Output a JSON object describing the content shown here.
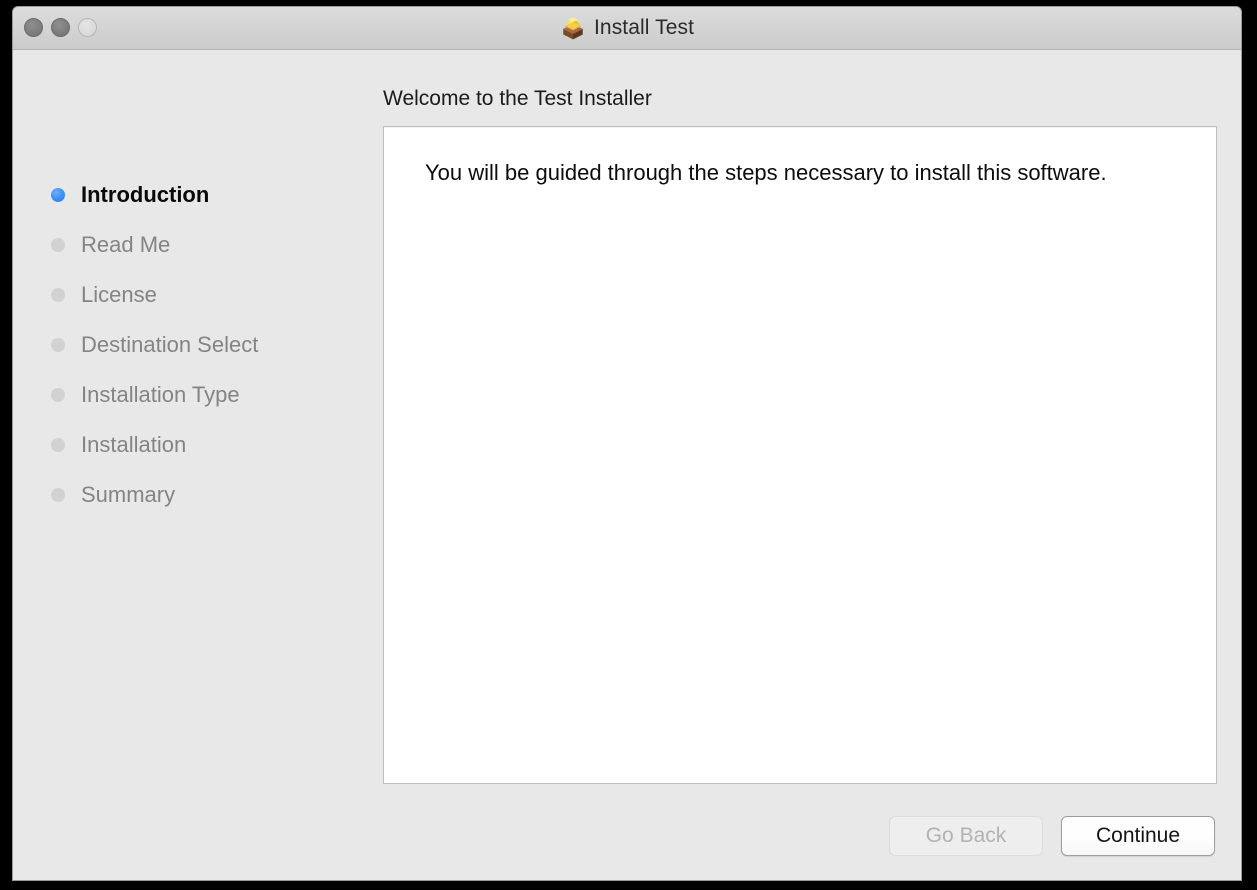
{
  "window": {
    "title": "Install Test",
    "icon": "package-installer-icon",
    "traffic_lights": [
      {
        "name": "close",
        "label": "Close"
      },
      {
        "name": "minimize",
        "label": "Minimize"
      },
      {
        "name": "zoom",
        "label": "Zoom"
      }
    ]
  },
  "sidebar": {
    "steps": [
      {
        "label": "Introduction",
        "active": true
      },
      {
        "label": "Read Me",
        "active": false
      },
      {
        "label": "License",
        "active": false
      },
      {
        "label": "Destination Select",
        "active": false
      },
      {
        "label": "Installation Type",
        "active": false
      },
      {
        "label": "Installation",
        "active": false
      },
      {
        "label": "Summary",
        "active": false
      }
    ]
  },
  "main": {
    "heading": "Welcome to the Test Installer",
    "body_text": "You will be guided through the steps necessary to install this software."
  },
  "footer": {
    "go_back_label": "Go Back",
    "continue_label": "Continue"
  },
  "colors": {
    "accent_dot": "#3b8cf5",
    "inactive_dot": "#d2d2d2",
    "window_background": "#e8e8e8",
    "titlebar_top": "#dcdcdc",
    "titlebar_bottom": "#cbcbcb",
    "content_background": "#ffffff",
    "active_step_text": "#0a0a0a",
    "inactive_step_text": "#848484",
    "disabled_button_text": "#b3b3b3"
  }
}
